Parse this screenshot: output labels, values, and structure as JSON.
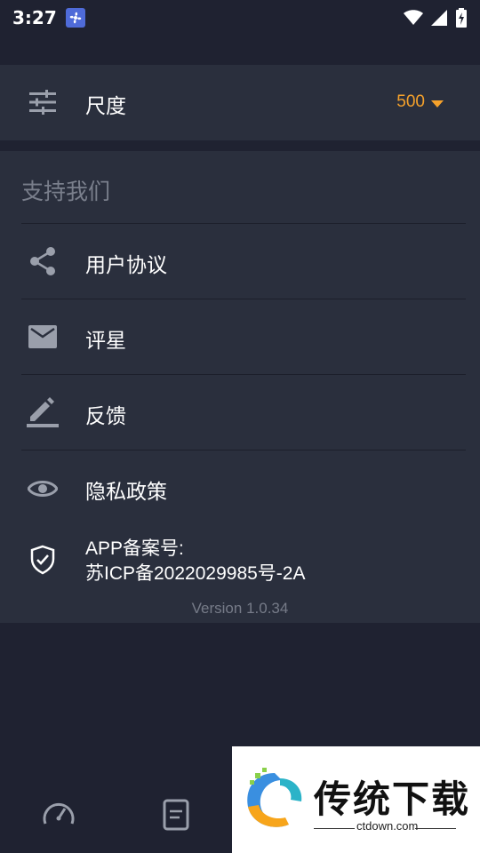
{
  "status_bar": {
    "time": "3:27"
  },
  "scale": {
    "label": "尺度",
    "value": "500"
  },
  "support": {
    "title": "支持我们",
    "items": [
      {
        "label": "用户协议",
        "icon": "share-icon"
      },
      {
        "label": "评星",
        "icon": "mail-icon"
      },
      {
        "label": "反馈",
        "icon": "edit-icon"
      },
      {
        "label": "隐私政策",
        "icon": "eye-icon"
      }
    ],
    "icp_line1": "APP备案号:",
    "icp_line2": "苏ICP备2022029985号-2A",
    "version": "Version 1.0.34"
  },
  "watermark": {
    "title": "传统下载",
    "site": "ctdown.com"
  },
  "colors": {
    "background": "#1f2231",
    "card": "#2a2f3d",
    "accent": "#f5a12b",
    "muted": "#7a7f8c"
  }
}
